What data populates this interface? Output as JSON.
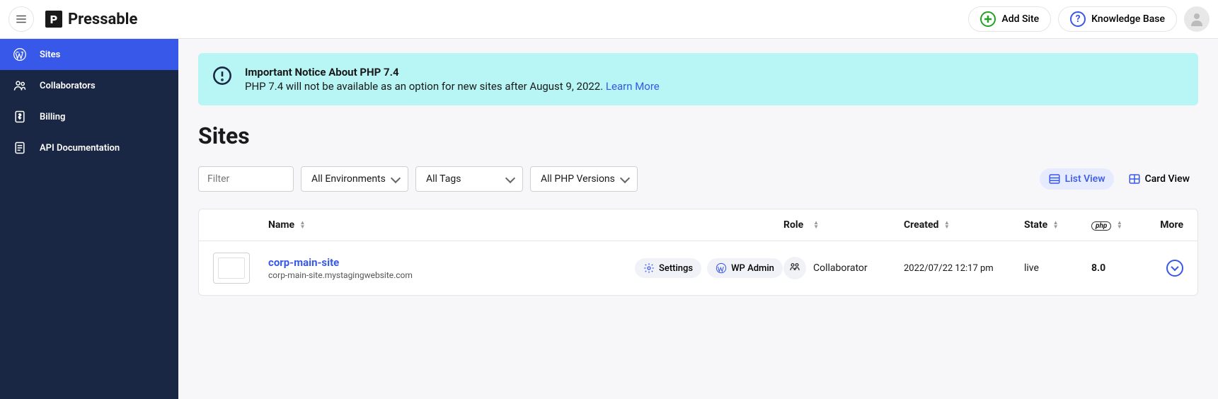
{
  "header": {
    "brand": "Pressable",
    "add_site": "Add Site",
    "knowledge_base": "Knowledge Base"
  },
  "sidebar": {
    "items": [
      {
        "label": "Sites"
      },
      {
        "label": "Collaborators"
      },
      {
        "label": "Billing"
      },
      {
        "label": "API Documentation"
      }
    ]
  },
  "notice": {
    "title": "Important Notice About PHP 7.4",
    "body": "PHP 7.4 will not be available as an option for new sites after August 9, 2022. ",
    "link": "Learn More"
  },
  "page_title": "Sites",
  "filters": {
    "filter_placeholder": "Filter",
    "env": "All Environments",
    "tags": "All Tags",
    "php": "All PHP Versions"
  },
  "view": {
    "list": "List View",
    "card": "Card View"
  },
  "table": {
    "headers": {
      "name": "Name",
      "role": "Role",
      "created": "Created",
      "state": "State",
      "php": "php",
      "more": "More"
    },
    "rows": [
      {
        "name": "corp-main-site",
        "url": "corp-main-site.mystagingwebsite.com",
        "settings": "Settings",
        "wp_admin": "WP Admin",
        "role": "Collaborator",
        "created": "2022/07/22 12:17 pm",
        "state": "live",
        "php": "8.0"
      }
    ]
  }
}
